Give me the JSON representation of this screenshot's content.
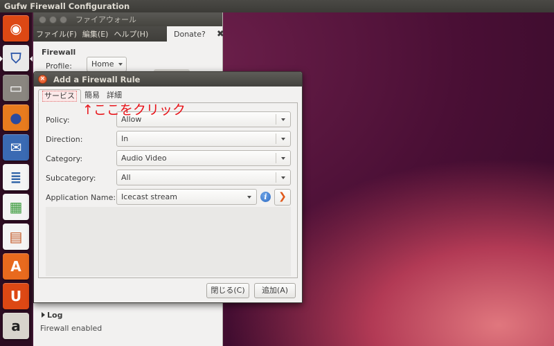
{
  "top_panel": {
    "title": "Gufw Firewall Configuration"
  },
  "launcher": {
    "items": [
      {
        "name": "dash-home",
        "glyph": "◉",
        "color": "#dd4814"
      },
      {
        "name": "gufw",
        "glyph": "⛉",
        "color": "#2a55a8"
      },
      {
        "name": "file-manager",
        "glyph": "▭",
        "color": "#8a8680"
      },
      {
        "name": "firefox",
        "glyph": "●",
        "color": "#e87b1e"
      },
      {
        "name": "thunderbird",
        "glyph": "✉",
        "color": "#3a6ab3"
      },
      {
        "name": "libreoffice-writer",
        "glyph": "≣",
        "color": "#2a5fa5"
      },
      {
        "name": "libreoffice-calc",
        "glyph": "▦",
        "color": "#3a9a3c"
      },
      {
        "name": "libreoffice-impress",
        "glyph": "▤",
        "color": "#c45a28"
      },
      {
        "name": "software-center",
        "glyph": "A",
        "color": "#e86a1e"
      },
      {
        "name": "ubuntu-one",
        "glyph": "U",
        "color": "#dd4814"
      },
      {
        "name": "amazon",
        "glyph": "a",
        "color": "#d8d4cc"
      }
    ]
  },
  "main_window": {
    "title": "ファイアウォール",
    "menu": [
      "ファイル(F)",
      "編集(E)",
      "ヘルプ(H)"
    ],
    "donate_label": "Donate?",
    "donate_close": "✖",
    "section_title": "Firewall",
    "profile_label": "Profile:",
    "profile_value": "Home",
    "cut_row": "+ + + + + + + + +",
    "log_label": "Log",
    "status": "Firewall enabled"
  },
  "dialog": {
    "title": "Add a Firewall Rule",
    "close_glyph": "×",
    "tabs": [
      "サービス",
      "簡易",
      "詳細"
    ],
    "annotation": "↑ここをクリック",
    "fields": {
      "policy": {
        "label": "Policy:",
        "value": "Allow"
      },
      "direction": {
        "label": "Direction:",
        "value": "In"
      },
      "category": {
        "label": "Category:",
        "value": "Audio Video"
      },
      "subcategory": {
        "label": "Subcategory:",
        "value": "All"
      },
      "application": {
        "label": "Application Name:",
        "value": "Icecast stream"
      }
    },
    "info_glyph": "i",
    "go_glyph": "❯",
    "close_button": "閉じる(C)",
    "add_button": "追加(A)"
  }
}
